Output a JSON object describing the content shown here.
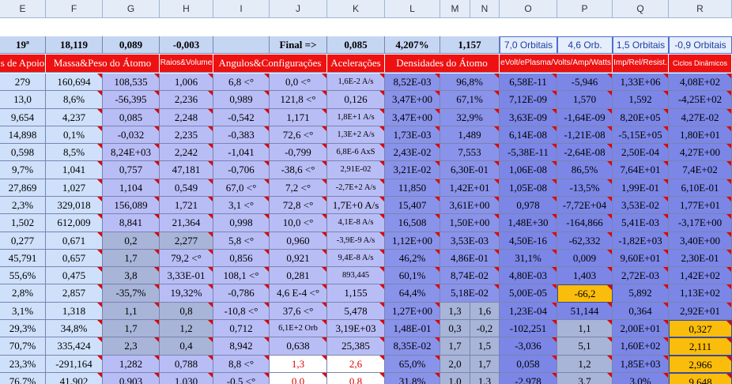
{
  "columns": [
    "E",
    "F",
    "G",
    "H",
    "I",
    "J",
    "K",
    "L",
    "M",
    "N",
    "O",
    "P",
    "Q",
    "R"
  ],
  "colors": {
    "pale": "#cfe0fa",
    "lilac": "#b9bdf6",
    "purple": "#8a93ea",
    "blue": "#7b86e6",
    "slate": "#a8b4d8",
    "gold": "#fbbd0b",
    "white": "#ffffff",
    "red": "#ee1111",
    "summary": "#c5d6f3",
    "summary_text": "#1c3fa3"
  },
  "summary_row": [
    {
      "text": "19ª",
      "bold": true
    },
    {
      "text": "18,119",
      "bold": true
    },
    {
      "text": "0,089",
      "bold": true
    },
    {
      "text": "-0,003",
      "bold": true
    },
    {
      "text": ""
    },
    {
      "text": "Final =>",
      "bold": true
    },
    {
      "text": "0,085",
      "bold": true
    },
    {
      "text": "4,207%",
      "bold": true
    },
    {
      "text": "1,157",
      "bold": true
    },
    {
      "text": "7,0 Orbitais",
      "blue": true
    },
    {
      "text": "4,6 Orb.",
      "blue": true
    },
    {
      "text": "1,5 Orbitais",
      "blue": true
    },
    {
      "text": "-0,9 Orbitais",
      "blue": true
    }
  ],
  "section_headers": [
    {
      "label": "s de Apoio"
    },
    {
      "label": "Massa&Peso do Átomo"
    },
    {
      "label": "Raios&Volume"
    },
    {
      "label": "Angulos&Configurações"
    },
    {
      "label": "Acelerações"
    },
    {
      "label": "Densidades do Átomo"
    },
    {
      "label": "eVolt/ePlasma/Volts/Amp/Watts"
    },
    {
      "label": "Imp/Rel/Resist."
    },
    {
      "label": "Ciclos Dinâmicos"
    }
  ],
  "rows": [
    [
      "279",
      "160,694",
      "108,535",
      "1,006",
      "6,8 <°",
      "0,0 <°",
      "1,6E-2 A/s",
      "8,52E-03",
      "96,8%",
      "",
      "6,58E-11",
      "-5,946",
      "1,33E+06",
      "4,08E+02"
    ],
    [
      "13,0",
      "8,6%",
      "-56,395",
      "2,236",
      "0,989",
      "121,8 <°",
      "0,126",
      "3,47E+00",
      "67,1%",
      "",
      "7,12E-09",
      "1,570",
      "1,592",
      "-4,25E+02"
    ],
    [
      "9,654",
      "4,237",
      "0,085",
      "2,248",
      "-0,542",
      "1,171",
      "1,8E+1 A/s",
      "3,47E+00",
      "32,9%",
      "",
      "3,63E-09",
      "-1,64E-09",
      "8,20E+05",
      "4,27E-02"
    ],
    [
      "14,898",
      "0,1%",
      "-0,032",
      "2,235",
      "-0,383",
      "72,6 <°",
      "1,3E+2 A/s",
      "1,73E-03",
      "1,489",
      "",
      "6,14E-08",
      "-1,21E-08",
      "-5,15E+05",
      "1,80E+01"
    ],
    [
      "0,598",
      "8,5%",
      "8,24E+03",
      "2,242",
      "-1,041",
      "-0,799",
      "6,8E-6 AxS",
      "2,43E-02",
      "7,553",
      "",
      "-5,38E-11",
      "-2,64E-08",
      "2,50E-04",
      "4,27E+00"
    ],
    [
      "9,7%",
      "1,041",
      "0,757",
      "47,181",
      "-0,706",
      "-38,6 <°",
      "2,91E-02",
      "3,21E-02",
      "6,30E-01",
      "",
      "1,06E-08",
      "86,5%",
      "7,64E+01",
      "7,4E+02"
    ],
    [
      "27,869",
      "1,027",
      "1,104",
      "0,549",
      "67,0 <°",
      "7,2 <°",
      "-2,7E+2 A/s",
      "11,850",
      "1,42E+01",
      "",
      "1,05E-08",
      "-13,5%",
      "1,99E-01",
      "6,10E-01"
    ],
    [
      "2,3%",
      "329,018",
      "156,089",
      "1,721",
      "3,1 <°",
      "72,8 <°",
      "1,7E+0 A/s",
      "15,407",
      "3,61E+00",
      "",
      "0,978",
      "-7,72E+04",
      "3,53E-02",
      "1,77E+01"
    ],
    [
      "1,502",
      "612,009",
      "8,841",
      "21,364",
      "0,998",
      "10,0 <°",
      "4,1E-8 A/s",
      "16,508",
      "1,50E+00",
      "",
      "1,48E+30",
      "-164,866",
      "5,41E-03",
      "-3,17E+00"
    ],
    [
      "0,277",
      "0,671",
      "0,2",
      "2,277",
      "5,8 <°",
      "0,960",
      "-3,9E-9 A/s",
      "1,12E+00",
      "3,53E-03",
      "",
      "4,50E-16",
      "-62,332",
      "-1,82E+03",
      "3,40E+00"
    ],
    [
      "45,791",
      "0,657",
      "1,7",
      "79,2 <°",
      "0,856",
      "0,921",
      "9,4E-8 A/s",
      "46,2%",
      "4,86E-01",
      "",
      "31,1%",
      "0,009",
      "9,60E+01",
      "2,30E-01"
    ],
    [
      "55,6%",
      "0,475",
      "3,8",
      "3,33E-01",
      "108,1 <°",
      "0,281",
      "893,445",
      "60,1%",
      "8,74E-02",
      "",
      "4,80E-03",
      "1,403",
      "2,72E-03",
      "1,42E+02"
    ],
    [
      "2,8%",
      "2,857",
      "-35,7%",
      "19,32%",
      "-0,786",
      "4,6 E-4 <°",
      "1,155",
      "64,4%",
      "5,18E-02",
      "",
      "5,00E-05",
      "-66,2",
      "5,892",
      "1,13E+02"
    ],
    [
      "3,1%",
      "1,318",
      "1,1",
      "0,8",
      "-10,8 <°",
      "37,6 <°",
      "5,478",
      "1,27E+00",
      "1,3",
      "1,6",
      "1,23E-04",
      "51,144",
      "0,364",
      "2,92E+01"
    ],
    [
      "29,3%",
      "34,8%",
      "1,7",
      "1,2",
      "0,712",
      "6,1E+2 Orb",
      "3,19E+03",
      "1,48E-01",
      "0,3",
      "-0,2",
      "-102,251",
      "1,1",
      "2,00E+01",
      "0,327"
    ],
    [
      "70,7%",
      "335,424",
      "2,3",
      "0,4",
      "8,942",
      "0,638",
      "25,385",
      "8,35E-02",
      "1,7",
      "1,5",
      "-3,036",
      "5,1",
      "1,60E+02",
      "2,111"
    ],
    [
      "23,3%",
      "-291,164",
      "1,282",
      "0,788",
      "8,8 <°",
      "1,3",
      "2,6",
      "65,0%",
      "2,0",
      "1,7",
      "0,058",
      "1,2",
      "1,85E+03",
      "2,966"
    ],
    [
      "76,7%",
      "41,902",
      "0,903",
      "1,030",
      "-0,5 <°",
      "0,0",
      "0,8",
      "31,8%",
      "1,0",
      "1,3",
      "-2,978",
      "3,7",
      "3,0%",
      "9,648"
    ]
  ]
}
